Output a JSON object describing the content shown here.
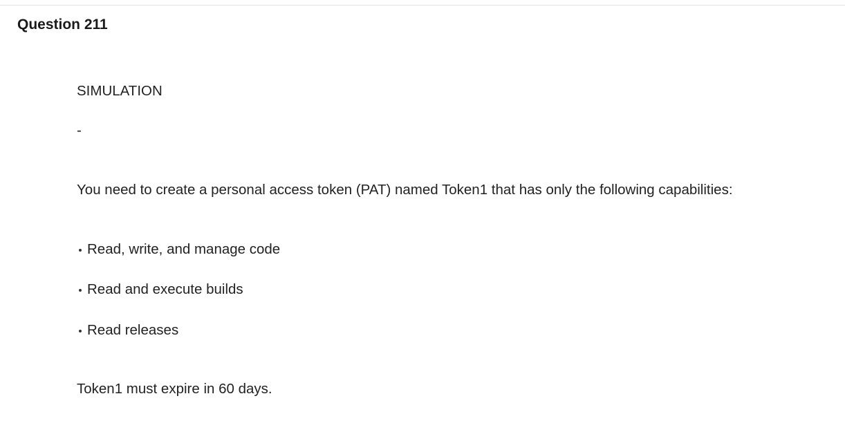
{
  "question": {
    "title": "Question 211"
  },
  "body": {
    "simulation_label": "SIMULATION",
    "separator": "-",
    "intro": "You need to create a personal access token (PAT) named Token1 that has only the following capabilities:",
    "capabilities": [
      "Read, write, and manage code",
      "Read and execute builds",
      "Read releases"
    ],
    "expiry": "Token1 must expire in 60 days."
  }
}
